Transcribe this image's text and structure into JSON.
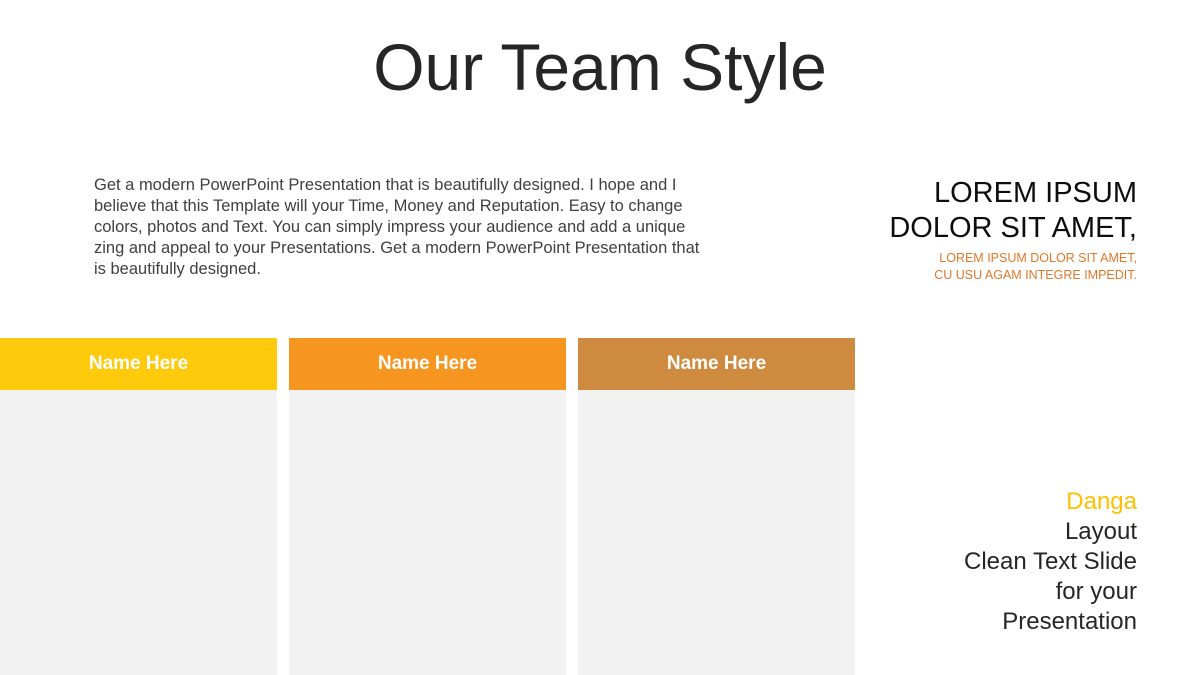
{
  "slide": {
    "title": "Our Team Style",
    "intro": "Get a modern PowerPoint  Presentation that is beautifully designed. I hope and I believe that this Template will your Time, Money and Reputation. Easy to change colors, photos and Text. You can simply impress your audience and add a unique zing and appeal to your Presentations. Get a modern PowerPoint  Presentation that is beautifully designed.",
    "side_heading": {
      "line1": "LOREM IPSUM",
      "line2": "DOLOR SIT AMET,"
    },
    "side_subheading": {
      "line1": "LOREM IPSUM DOLOR SIT AMET,",
      "line2": "CU USU AGAM INTEGRE IMPEDIT."
    },
    "cards": [
      {
        "name": "Name Here",
        "color": "#ffc90c"
      },
      {
        "name": "Name Here",
        "color": "#f79521"
      },
      {
        "name": "Name Here",
        "color": "#ce8b3f"
      }
    ],
    "side_bottom": {
      "accent": "Danga",
      "line1": "Layout",
      "line2": "Clean Text Slide",
      "line3": "for your",
      "line4": "Presentation"
    }
  },
  "colors": {
    "title_text": "#262626",
    "body_text": "#404040",
    "sub_accent": "#e0782a",
    "accent_yellow": "#ffc000",
    "card_fill": "#f2f2f2"
  }
}
